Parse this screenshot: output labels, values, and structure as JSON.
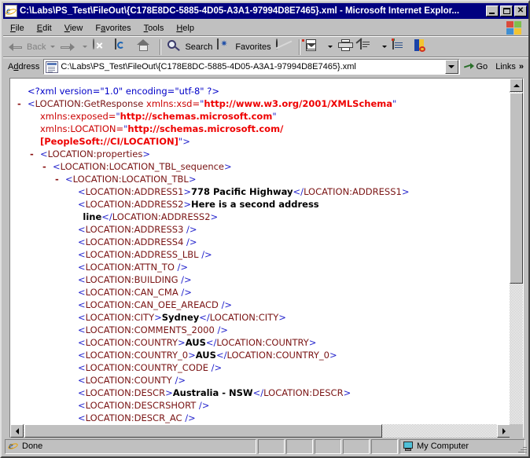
{
  "window": {
    "title": "C:\\Labs\\PS_Test\\FileOut\\{C178E8DC-5885-4D05-A3A1-97994D8E7465}.xml - Microsoft Internet Explor...",
    "minimize_label": "_",
    "maximize_label": "□",
    "close_label": "×"
  },
  "menu": {
    "items": [
      {
        "pre": "",
        "acc": "F",
        "post": "ile"
      },
      {
        "pre": "",
        "acc": "E",
        "post": "dit"
      },
      {
        "pre": "",
        "acc": "V",
        "post": "iew"
      },
      {
        "pre": "F",
        "acc": "a",
        "post": "vorites"
      },
      {
        "pre": "",
        "acc": "T",
        "post": "ools"
      },
      {
        "pre": "",
        "acc": "H",
        "post": "elp"
      }
    ]
  },
  "toolbar": {
    "back_label": "Back",
    "forward_label": "",
    "stop_label": "",
    "refresh_label": "",
    "home_label": "",
    "search_label": "Search",
    "favorites_label": "Favorites",
    "history_label": "",
    "mail_label": "",
    "print_label": "",
    "edit_label": "",
    "discuss_label": "",
    "research_label": ""
  },
  "address": {
    "label_pre": "A",
    "label_acc": "d",
    "label_post": "dress",
    "value": "C:\\Labs\\PS_Test\\FileOut\\{C178E8DC-5885-4D05-A3A1-97994D8E7465}.xml",
    "placeholder": "",
    "go_label": "Go",
    "links_label": "Links",
    "chevron": "»"
  },
  "status": {
    "message": "Done",
    "zone": "My Computer"
  },
  "xml": {
    "lines": [
      {
        "indent": 0,
        "marker": "",
        "segs": [
          {
            "t": "pi",
            "v": "<?xml version=\"1.0\" encoding=\"utf-8\" ?>"
          }
        ]
      },
      {
        "indent": 0,
        "marker": "-",
        "segs": [
          {
            "t": "br",
            "v": "<"
          },
          {
            "t": "tag",
            "v": "LOCATION:GetResponse"
          },
          {
            "t": "sp",
            "v": " "
          },
          {
            "t": "attr",
            "v": "xmlns:xsd="
          },
          {
            "t": "q",
            "v": "\""
          },
          {
            "t": "aval",
            "v": "http://www.w3.org/2001/XMLSchema"
          },
          {
            "t": "q",
            "v": "\""
          }
        ]
      },
      {
        "indent": 1,
        "marker": "",
        "segs": [
          {
            "t": "attr",
            "v": "xmlns:exposed="
          },
          {
            "t": "q",
            "v": "\""
          },
          {
            "t": "aval",
            "v": "http://schemas.microsoft.com"
          },
          {
            "t": "q",
            "v": "\""
          }
        ]
      },
      {
        "indent": 1,
        "marker": "",
        "segs": [
          {
            "t": "attr",
            "v": "xmlns:LOCATION="
          },
          {
            "t": "q",
            "v": "\""
          },
          {
            "t": "aval",
            "v": "http://schemas.microsoft.com/"
          }
        ]
      },
      {
        "indent": 1,
        "marker": "",
        "segs": [
          {
            "t": "aval",
            "v": "[PeopleSoft://CI/LOCATION]"
          },
          {
            "t": "q",
            "v": "\""
          },
          {
            "t": "br",
            "v": ">"
          }
        ]
      },
      {
        "indent": 1,
        "marker": "-",
        "segs": [
          {
            "t": "br",
            "v": "<"
          },
          {
            "t": "tag",
            "v": "LOCATION:properties"
          },
          {
            "t": "br",
            "v": ">"
          }
        ]
      },
      {
        "indent": 2,
        "marker": "-",
        "segs": [
          {
            "t": "br",
            "v": "<"
          },
          {
            "t": "tag",
            "v": "LOCATION:LOCATION_TBL_sequence"
          },
          {
            "t": "br",
            "v": ">"
          }
        ]
      },
      {
        "indent": 3,
        "marker": "-",
        "segs": [
          {
            "t": "br",
            "v": "<"
          },
          {
            "t": "tag",
            "v": "LOCATION:LOCATION_TBL"
          },
          {
            "t": "br",
            "v": ">"
          }
        ]
      },
      {
        "indent": 4,
        "marker": "",
        "segs": [
          {
            "t": "br",
            "v": "<"
          },
          {
            "t": "tag",
            "v": "LOCATION:ADDRESS1"
          },
          {
            "t": "br",
            "v": ">"
          },
          {
            "t": "val",
            "v": "778 Pacific Highway"
          },
          {
            "t": "br",
            "v": "</"
          },
          {
            "t": "tag",
            "v": "LOCATION:ADDRESS1"
          },
          {
            "t": "br",
            "v": ">"
          }
        ]
      },
      {
        "indent": 4,
        "marker": "",
        "segs": [
          {
            "t": "br",
            "v": "<"
          },
          {
            "t": "tag",
            "v": "LOCATION:ADDRESS2"
          },
          {
            "t": "br",
            "v": ">"
          },
          {
            "t": "val",
            "v": "Here is a second address"
          }
        ]
      },
      {
        "indent": 4.4,
        "marker": "",
        "segs": [
          {
            "t": "val",
            "v": "line"
          },
          {
            "t": "br",
            "v": "</"
          },
          {
            "t": "tag",
            "v": "LOCATION:ADDRESS2"
          },
          {
            "t": "br",
            "v": ">"
          }
        ]
      },
      {
        "indent": 4,
        "marker": "",
        "segs": [
          {
            "t": "br",
            "v": "<"
          },
          {
            "t": "tag",
            "v": "LOCATION:ADDRESS3"
          },
          {
            "t": "sp",
            "v": " "
          },
          {
            "t": "br",
            "v": "/>"
          }
        ]
      },
      {
        "indent": 4,
        "marker": "",
        "segs": [
          {
            "t": "br",
            "v": "<"
          },
          {
            "t": "tag",
            "v": "LOCATION:ADDRESS4"
          },
          {
            "t": "sp",
            "v": " "
          },
          {
            "t": "br",
            "v": "/>"
          }
        ]
      },
      {
        "indent": 4,
        "marker": "",
        "segs": [
          {
            "t": "br",
            "v": "<"
          },
          {
            "t": "tag",
            "v": "LOCATION:ADDRESS_LBL"
          },
          {
            "t": "sp",
            "v": " "
          },
          {
            "t": "br",
            "v": "/>"
          }
        ]
      },
      {
        "indent": 4,
        "marker": "",
        "segs": [
          {
            "t": "br",
            "v": "<"
          },
          {
            "t": "tag",
            "v": "LOCATION:ATTN_TO"
          },
          {
            "t": "sp",
            "v": " "
          },
          {
            "t": "br",
            "v": "/>"
          }
        ]
      },
      {
        "indent": 4,
        "marker": "",
        "segs": [
          {
            "t": "br",
            "v": "<"
          },
          {
            "t": "tag",
            "v": "LOCATION:BUILDING"
          },
          {
            "t": "sp",
            "v": " "
          },
          {
            "t": "br",
            "v": "/>"
          }
        ]
      },
      {
        "indent": 4,
        "marker": "",
        "segs": [
          {
            "t": "br",
            "v": "<"
          },
          {
            "t": "tag",
            "v": "LOCATION:CAN_CMA"
          },
          {
            "t": "sp",
            "v": " "
          },
          {
            "t": "br",
            "v": "/>"
          }
        ]
      },
      {
        "indent": 4,
        "marker": "",
        "segs": [
          {
            "t": "br",
            "v": "<"
          },
          {
            "t": "tag",
            "v": "LOCATION:CAN_OEE_AREACD"
          },
          {
            "t": "sp",
            "v": " "
          },
          {
            "t": "br",
            "v": "/>"
          }
        ]
      },
      {
        "indent": 4,
        "marker": "",
        "segs": [
          {
            "t": "br",
            "v": "<"
          },
          {
            "t": "tag",
            "v": "LOCATION:CITY"
          },
          {
            "t": "br",
            "v": ">"
          },
          {
            "t": "val",
            "v": "Sydney"
          },
          {
            "t": "br",
            "v": "</"
          },
          {
            "t": "tag",
            "v": "LOCATION:CITY"
          },
          {
            "t": "br",
            "v": ">"
          }
        ]
      },
      {
        "indent": 4,
        "marker": "",
        "segs": [
          {
            "t": "br",
            "v": "<"
          },
          {
            "t": "tag",
            "v": "LOCATION:COMMENTS_2000"
          },
          {
            "t": "sp",
            "v": " "
          },
          {
            "t": "br",
            "v": "/>"
          }
        ]
      },
      {
        "indent": 4,
        "marker": "",
        "segs": [
          {
            "t": "br",
            "v": "<"
          },
          {
            "t": "tag",
            "v": "LOCATION:COUNTRY"
          },
          {
            "t": "br",
            "v": ">"
          },
          {
            "t": "val",
            "v": "AUS"
          },
          {
            "t": "br",
            "v": "</"
          },
          {
            "t": "tag",
            "v": "LOCATION:COUNTRY"
          },
          {
            "t": "br",
            "v": ">"
          }
        ]
      },
      {
        "indent": 4,
        "marker": "",
        "segs": [
          {
            "t": "br",
            "v": "<"
          },
          {
            "t": "tag",
            "v": "LOCATION:COUNTRY_0"
          },
          {
            "t": "br",
            "v": ">"
          },
          {
            "t": "val",
            "v": "AUS"
          },
          {
            "t": "br",
            "v": "</"
          },
          {
            "t": "tag",
            "v": "LOCATION:COUNTRY_0"
          },
          {
            "t": "br",
            "v": ">"
          }
        ]
      },
      {
        "indent": 4,
        "marker": "",
        "segs": [
          {
            "t": "br",
            "v": "<"
          },
          {
            "t": "tag",
            "v": "LOCATION:COUNTRY_CODE"
          },
          {
            "t": "sp",
            "v": " "
          },
          {
            "t": "br",
            "v": "/>"
          }
        ]
      },
      {
        "indent": 4,
        "marker": "",
        "segs": [
          {
            "t": "br",
            "v": "<"
          },
          {
            "t": "tag",
            "v": "LOCATION:COUNTY"
          },
          {
            "t": "sp",
            "v": " "
          },
          {
            "t": "br",
            "v": "/>"
          }
        ]
      },
      {
        "indent": 4,
        "marker": "",
        "segs": [
          {
            "t": "br",
            "v": "<"
          },
          {
            "t": "tag",
            "v": "LOCATION:DESCR"
          },
          {
            "t": "br",
            "v": ">"
          },
          {
            "t": "val",
            "v": "Australia - NSW"
          },
          {
            "t": "br",
            "v": "</"
          },
          {
            "t": "tag",
            "v": "LOCATION:DESCR"
          },
          {
            "t": "br",
            "v": ">"
          }
        ]
      },
      {
        "indent": 4,
        "marker": "",
        "segs": [
          {
            "t": "br",
            "v": "<"
          },
          {
            "t": "tag",
            "v": "LOCATION:DESCRSHORT"
          },
          {
            "t": "sp",
            "v": " "
          },
          {
            "t": "br",
            "v": "/>"
          }
        ]
      },
      {
        "indent": 4,
        "marker": "",
        "segs": [
          {
            "t": "br",
            "v": "<"
          },
          {
            "t": "tag",
            "v": "LOCATION:DESCR_AC"
          },
          {
            "t": "sp",
            "v": " "
          },
          {
            "t": "br",
            "v": "/>"
          }
        ]
      }
    ]
  },
  "colors": {
    "titlebar": "#000080",
    "chrome": "#c0c0c0",
    "tag_name": "#7a1414",
    "bracket": "#2222cc",
    "attr_name": "#cc0000",
    "attr_value": "#ee0000",
    "text_value": "#000000",
    "pi": "#0000c8"
  }
}
